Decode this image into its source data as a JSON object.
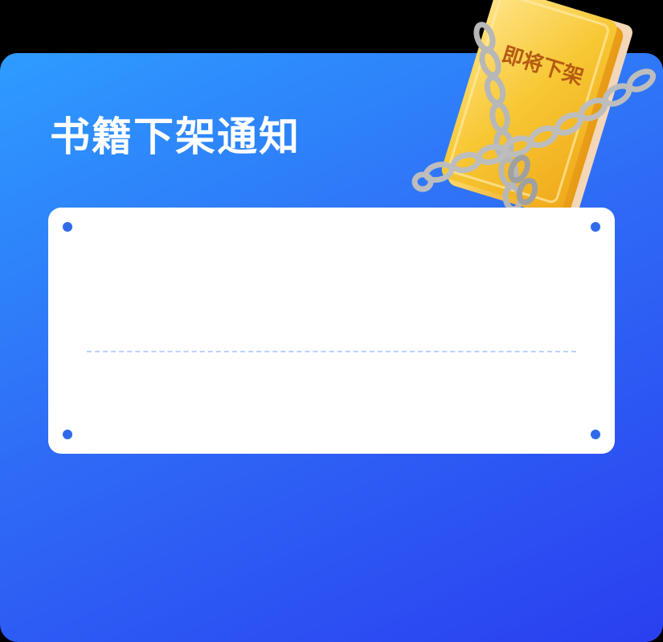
{
  "notice": {
    "title": "书籍下架通知"
  },
  "book": {
    "cover_label": "即将下架"
  },
  "colors": {
    "background_black": "#000000",
    "gradient_start": "#2e9cff",
    "gradient_end": "#2a3ff0",
    "panel": "#ffffff",
    "panel_dot": "#2f6be9",
    "divider": "#b9d3f5",
    "book_gold": "#f7c733",
    "book_label": "#b55a12",
    "chain": "#b8b8b8"
  },
  "icons": {
    "book": "locked-book-icon",
    "chain": "chain-icon"
  }
}
